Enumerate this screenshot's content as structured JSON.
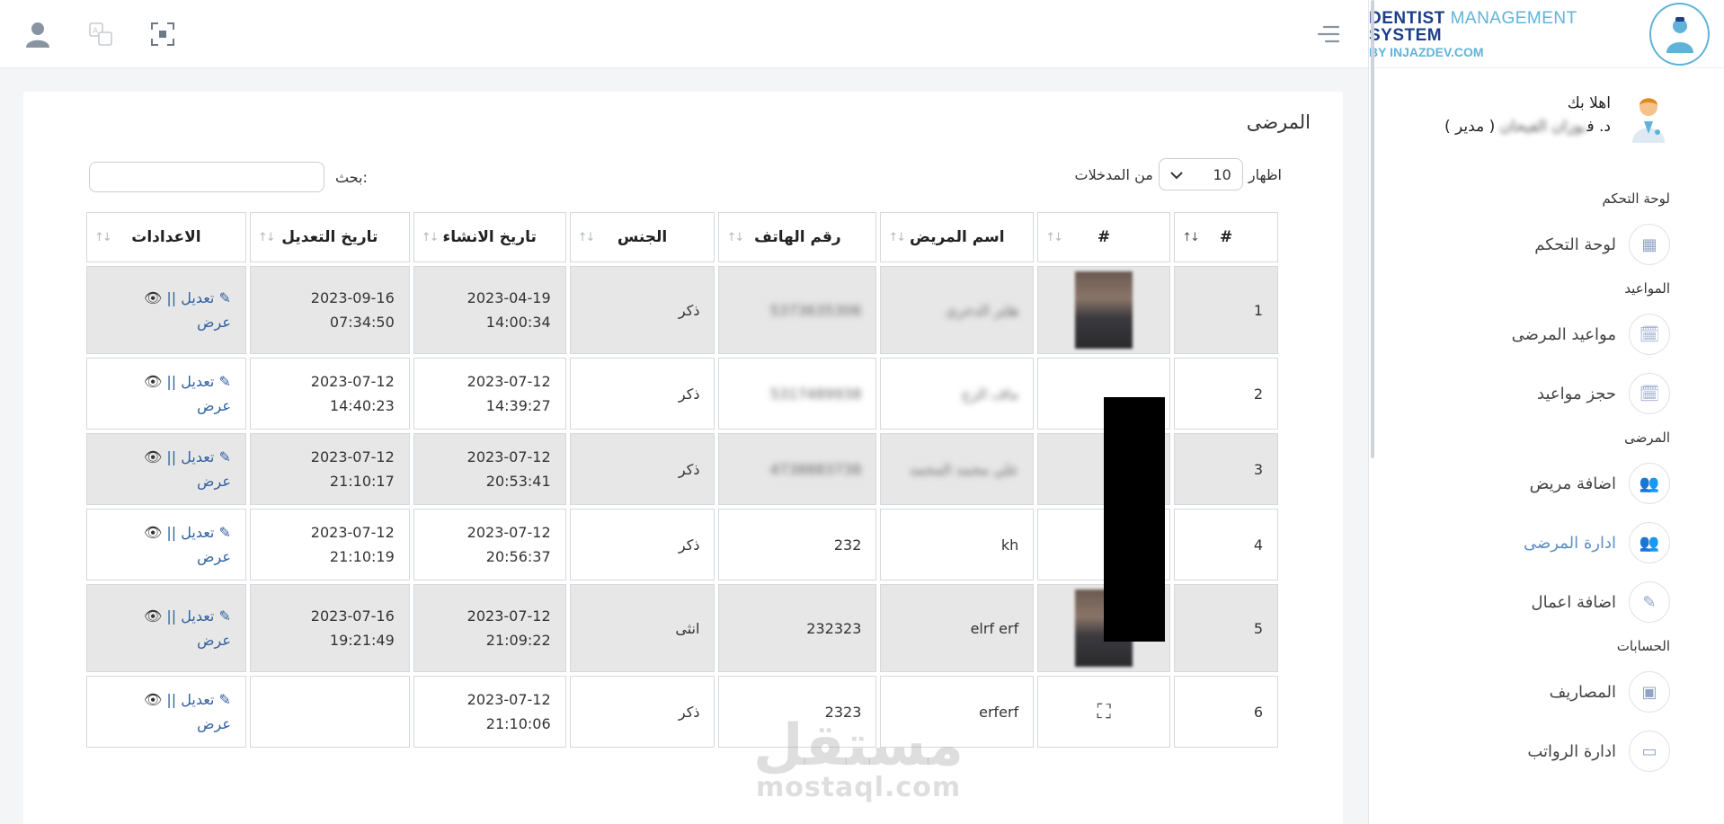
{
  "brand": {
    "title_dark": "DENTIST ",
    "title_light": "MANAGEMENT",
    "title_dark2": " SYSTEM",
    "subtitle": "BY INJAZDEV.COM"
  },
  "user": {
    "greeting": "اهلا بك",
    "name_prefix": "د. ف",
    "name_blur": "ـوزان الفيحان",
    "role": "( مدير )"
  },
  "menu": {
    "sections": [
      {
        "title": "لوحة التحكم",
        "items": [
          {
            "label": "لوحة التحكم",
            "icon": "dashboard-icon",
            "glyph": "▦"
          }
        ]
      },
      {
        "title": "المواعيد",
        "items": [
          {
            "label": "مواعيد المرضى",
            "icon": "calendar-icon",
            "glyph": "🗓"
          },
          {
            "label": "حجز مواعيد",
            "icon": "calendar-add-icon",
            "glyph": "🗓"
          }
        ]
      },
      {
        "title": "المرضى",
        "items": [
          {
            "label": "اضافة مريض",
            "icon": "user-add-icon",
            "glyph": "👥"
          },
          {
            "label": "ادارة المرضى",
            "icon": "users-icon",
            "glyph": "👥",
            "active": true
          },
          {
            "label": "اضافة اعمال",
            "icon": "magic-wand-icon",
            "glyph": "✎"
          }
        ]
      },
      {
        "title": "الحسابات",
        "items": [
          {
            "label": "المصاريف",
            "icon": "money-icon",
            "glyph": "▣"
          },
          {
            "label": "ادارة الرواتب",
            "icon": "wallet-icon",
            "glyph": "▭"
          }
        ]
      }
    ]
  },
  "page": {
    "title": "المرضى",
    "length_prefix": "اظهار",
    "length_value": "10",
    "length_suffix": "من المدخلات",
    "search_label": "بحث:",
    "search_value": ""
  },
  "table": {
    "headers": [
      "#",
      "#",
      "اسم المريض",
      "رقم الهاتف",
      "الجنس",
      "تاريخ الانشاء",
      "تاريخ التعديل",
      "الاعدادات"
    ],
    "edit_label": "تعديل ||",
    "view_label": "عرض",
    "rows": [
      {
        "id": "1",
        "name": "هلتر الدحرى",
        "phone": "5373635306",
        "gender": "ذكر",
        "created_date": "2023-04-19",
        "created_time": "14:00:34",
        "updated_date": "2023-09-16",
        "updated_time": "07:34:50",
        "photo": "blurred"
      },
      {
        "id": "2",
        "name": "ماف الزج",
        "phone": "5317489938",
        "gender": "ذكر",
        "created_date": "2023-07-12",
        "created_time": "14:39:27",
        "updated_date": "2023-07-12",
        "updated_time": "14:40:23",
        "photo": "redacted"
      },
      {
        "id": "3",
        "name": "علي محمد المحمد",
        "phone": "4738883738",
        "gender": "ذكر",
        "created_date": "2023-07-12",
        "created_time": "20:53:41",
        "updated_date": "2023-07-12",
        "updated_time": "21:10:17",
        "photo": "redacted"
      },
      {
        "id": "4",
        "name": "kh",
        "phone": "232",
        "gender": "ذكر",
        "created_date": "2023-07-12",
        "created_time": "20:56:37",
        "updated_date": "2023-07-12",
        "updated_time": "21:10:19",
        "photo": "redacted"
      },
      {
        "id": "5",
        "name": "elrf erf",
        "phone": "232323",
        "gender": "انثى",
        "created_date": "2023-07-12",
        "created_time": "21:09:22",
        "updated_date": "2023-07-16",
        "updated_time": "19:21:49",
        "photo": "blurred"
      },
      {
        "id": "6",
        "name": "erferf",
        "phone": "2323",
        "gender": "ذكر",
        "created_date": "2023-07-12",
        "created_time": "21:10:06",
        "updated_date": "",
        "updated_time": "",
        "photo": "broken"
      }
    ]
  },
  "watermark": {
    "arabic": "مستقل",
    "latin": "mostaql.com"
  }
}
